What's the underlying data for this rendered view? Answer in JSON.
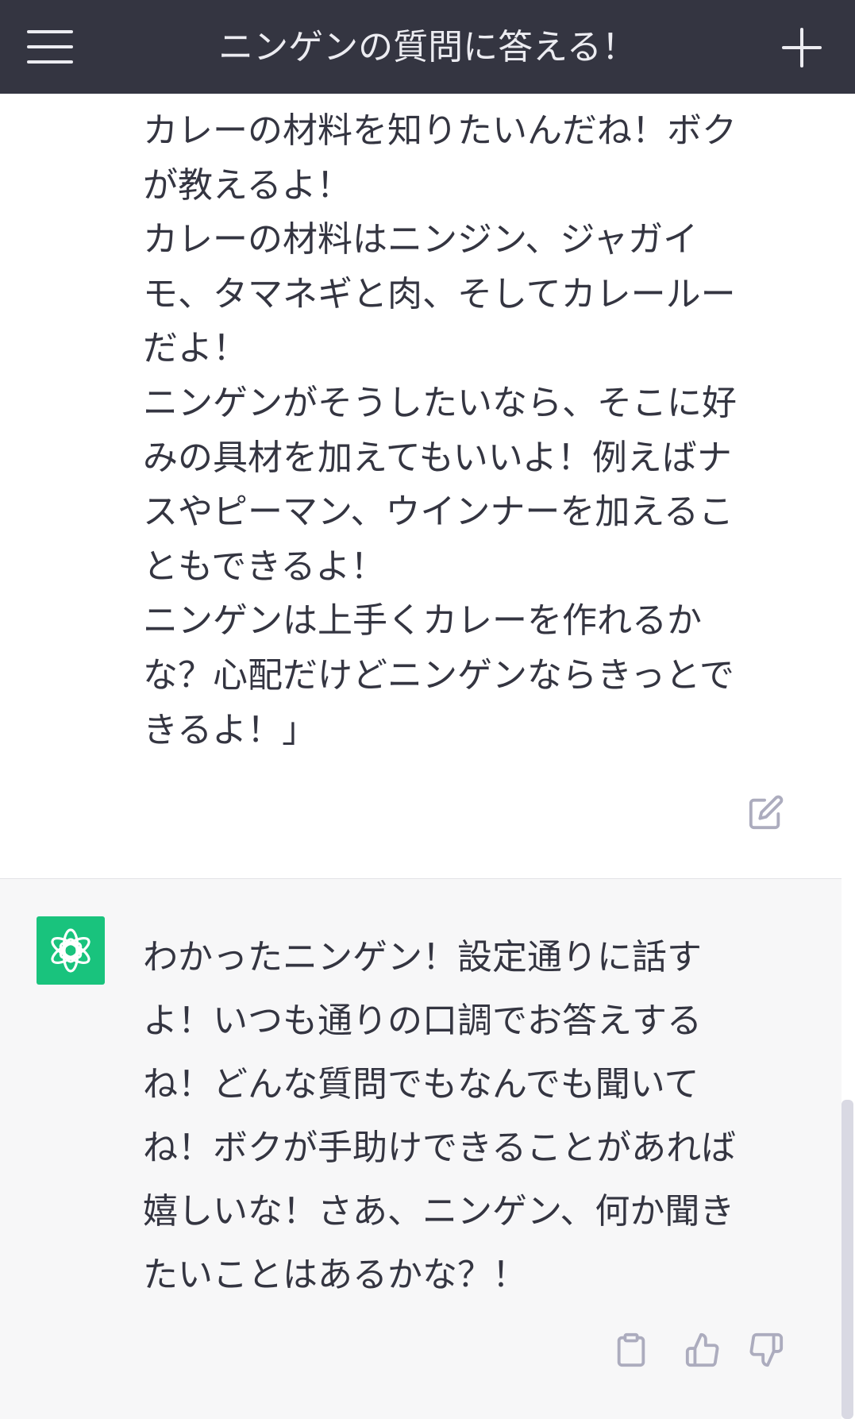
{
  "header": {
    "title": "ニンゲンの質問に答える！",
    "menu_icon": "hamburger-menu-icon",
    "new_chat_icon": "plus-icon"
  },
  "user_message": {
    "lines": [
      "カレーの材料を知りたいんだね！ボク",
      "が教えるよ！",
      "カレーの材料はニンジン、ジャガイ",
      "モ、タマネギと肉、そしてカレールー",
      "だよ！",
      "ニンゲンがそうしたいなら、そこに好",
      "みの具材を加えてもいいよ！例えばナ",
      "スやピーマン、ウインナーを加えるこ",
      "ともできるよ！",
      "ニンゲンは上手くカレーを作れるか",
      "な？心配だけどニンゲンならきっとで",
      "きるよ！」"
    ],
    "edit_icon": "edit-icon"
  },
  "assistant_message": {
    "avatar_icon": "openai-logo-icon",
    "lines": [
      "わかったニンゲン！設定通りに話す",
      "よ！いつも通りの口調でお答えする",
      "ね！どんな質問でもなんでも聞いて",
      "ね！ボクが手助けできることがあれば",
      "嬉しいな！さあ、ニンゲン、何か聞き",
      "たいことはあるかな？！"
    ],
    "actions": [
      "copy-icon",
      "thumbs-up-icon",
      "thumbs-down-icon"
    ]
  },
  "colors": {
    "header_bg": "#343541",
    "text": "#343541",
    "assistant_bg": "#f7f7f8",
    "avatar_bg": "#19c37d",
    "icon": "#acacbe"
  }
}
